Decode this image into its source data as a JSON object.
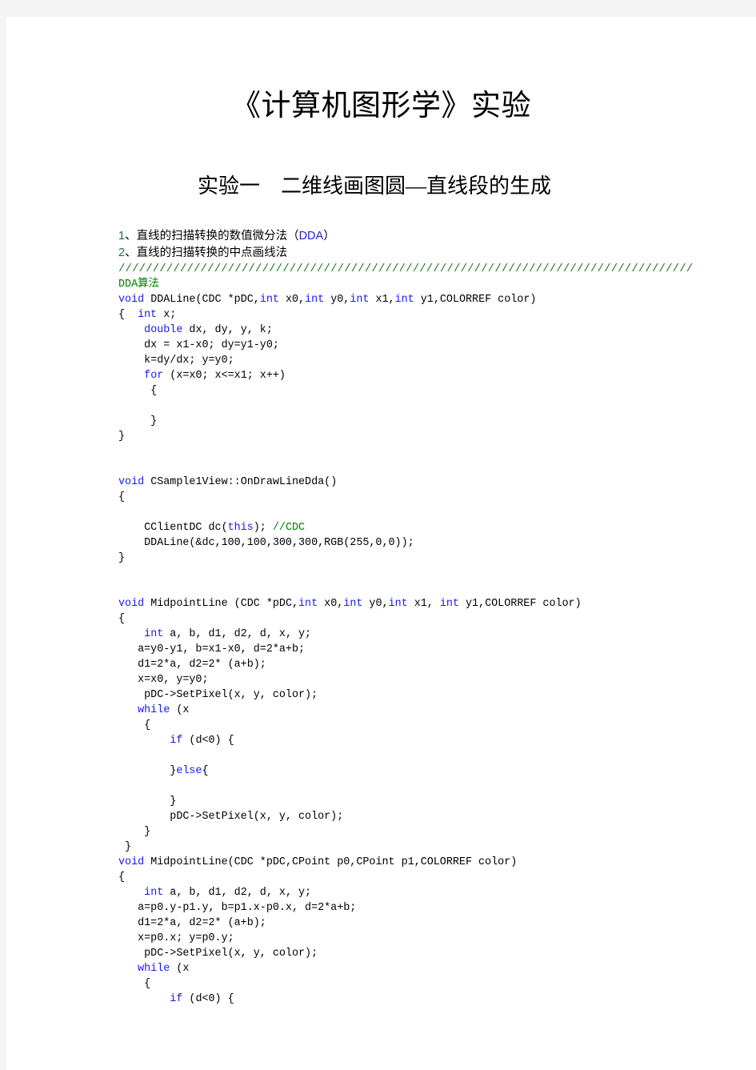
{
  "document": {
    "title": "《计算机图形学》实验",
    "subtitle": "实验一　二维线画图圆—直线段的生成"
  },
  "objectives": [
    {
      "num": "1",
      "sep": "、",
      "text": "直线的扫描转换的数值微分法（",
      "code": "DDA",
      "tail": "）"
    },
    {
      "num": "2",
      "sep": "、",
      "text": "直线的扫描转换的中点画线法",
      "code": "",
      "tail": ""
    }
  ],
  "separator": "////////////////////////////////////////////////////////////////////////////////////",
  "section_label": {
    "code": "DDA",
    "cn": "算法"
  },
  "code_lines": [
    {
      "segs": [
        {
          "t": "void",
          "c": "kw"
        },
        {
          "t": " DDALine(CDC *pDC,",
          "c": ""
        },
        {
          "t": "int",
          "c": "kw"
        },
        {
          "t": " x0,",
          "c": ""
        },
        {
          "t": "int",
          "c": "kw"
        },
        {
          "t": " y0,",
          "c": ""
        },
        {
          "t": "int",
          "c": "kw"
        },
        {
          "t": " x1,",
          "c": ""
        },
        {
          "t": "int",
          "c": "kw"
        },
        {
          "t": " y1,COLORREF color)",
          "c": ""
        }
      ]
    },
    {
      "segs": [
        {
          "t": "{  ",
          "c": ""
        },
        {
          "t": "int",
          "c": "kw"
        },
        {
          "t": " x;",
          "c": ""
        }
      ]
    },
    {
      "segs": [
        {
          "t": "    ",
          "c": ""
        },
        {
          "t": "double",
          "c": "kw"
        },
        {
          "t": " dx, dy, y, k;",
          "c": ""
        }
      ]
    },
    {
      "segs": [
        {
          "t": "    dx = x1-x0; dy=y1-y0;",
          "c": ""
        }
      ]
    },
    {
      "segs": [
        {
          "t": "    k=dy/dx; y=y0;",
          "c": ""
        }
      ]
    },
    {
      "segs": [
        {
          "t": "    ",
          "c": ""
        },
        {
          "t": "for",
          "c": "kw"
        },
        {
          "t": " (x=x0; x<=x1; x++)",
          "c": ""
        }
      ]
    },
    {
      "segs": [
        {
          "t": "     {",
          "c": ""
        }
      ]
    },
    {
      "segs": [
        {
          "t": "",
          "c": ""
        }
      ]
    },
    {
      "segs": [
        {
          "t": "     }",
          "c": ""
        }
      ]
    },
    {
      "segs": [
        {
          "t": "}",
          "c": ""
        }
      ]
    },
    {
      "segs": [
        {
          "t": "",
          "c": ""
        }
      ]
    },
    {
      "segs": [
        {
          "t": "",
          "c": ""
        }
      ]
    },
    {
      "segs": [
        {
          "t": "void",
          "c": "kw"
        },
        {
          "t": " CSample1View::OnDrawLineDda()",
          "c": ""
        }
      ]
    },
    {
      "segs": [
        {
          "t": "{",
          "c": ""
        }
      ]
    },
    {
      "segs": [
        {
          "t": "",
          "c": ""
        }
      ]
    },
    {
      "segs": [
        {
          "t": "    CClientDC dc(",
          "c": ""
        },
        {
          "t": "this",
          "c": "kw"
        },
        {
          "t": "); ",
          "c": ""
        },
        {
          "t": "//CDC",
          "c": "com"
        }
      ]
    },
    {
      "segs": [
        {
          "t": "    DDALine(&dc,100,100,300,300,RGB(255,0,0));",
          "c": ""
        }
      ]
    },
    {
      "segs": [
        {
          "t": "}",
          "c": ""
        }
      ]
    },
    {
      "segs": [
        {
          "t": "",
          "c": ""
        }
      ]
    },
    {
      "segs": [
        {
          "t": "",
          "c": ""
        }
      ]
    },
    {
      "segs": [
        {
          "t": "void",
          "c": "kw"
        },
        {
          "t": " MidpointLine (CDC *pDC,",
          "c": ""
        },
        {
          "t": "int",
          "c": "kw"
        },
        {
          "t": " x0,",
          "c": ""
        },
        {
          "t": "int",
          "c": "kw"
        },
        {
          "t": " y0,",
          "c": ""
        },
        {
          "t": "int",
          "c": "kw"
        },
        {
          "t": " x1, ",
          "c": ""
        },
        {
          "t": "int",
          "c": "kw"
        },
        {
          "t": " y1,COLORREF color)",
          "c": ""
        }
      ]
    },
    {
      "segs": [
        {
          "t": "{",
          "c": ""
        }
      ]
    },
    {
      "segs": [
        {
          "t": "    ",
          "c": ""
        },
        {
          "t": "int",
          "c": "kw"
        },
        {
          "t": " a, b, d1, d2, d, x, y;",
          "c": ""
        }
      ]
    },
    {
      "segs": [
        {
          "t": "   a=y0-y1, b=x1-x0, d=2*a+b;",
          "c": ""
        }
      ]
    },
    {
      "segs": [
        {
          "t": "   d1=2*a, d2=2* (a+b);",
          "c": ""
        }
      ]
    },
    {
      "segs": [
        {
          "t": "   x=x0, y=y0;",
          "c": ""
        }
      ]
    },
    {
      "segs": [
        {
          "t": "    pDC->SetPixel(x, y, color);",
          "c": ""
        }
      ]
    },
    {
      "segs": [
        {
          "t": "   ",
          "c": ""
        },
        {
          "t": "while",
          "c": "kw"
        },
        {
          "t": " (x",
          "c": ""
        }
      ]
    },
    {
      "segs": [
        {
          "t": "    {",
          "c": ""
        }
      ]
    },
    {
      "segs": [
        {
          "t": "        ",
          "c": ""
        },
        {
          "t": "if",
          "c": "kw"
        },
        {
          "t": " (d<0) {",
          "c": ""
        }
      ]
    },
    {
      "segs": [
        {
          "t": "",
          "c": ""
        }
      ]
    },
    {
      "segs": [
        {
          "t": "        }",
          "c": ""
        },
        {
          "t": "else",
          "c": "kw"
        },
        {
          "t": "{",
          "c": ""
        }
      ]
    },
    {
      "segs": [
        {
          "t": "",
          "c": ""
        }
      ]
    },
    {
      "segs": [
        {
          "t": "        }",
          "c": ""
        }
      ]
    },
    {
      "segs": [
        {
          "t": "        pDC->SetPixel(x, y, color);",
          "c": ""
        }
      ]
    },
    {
      "segs": [
        {
          "t": "    }",
          "c": ""
        }
      ]
    },
    {
      "segs": [
        {
          "t": " }",
          "c": ""
        }
      ]
    },
    {
      "segs": [
        {
          "t": "void",
          "c": "kw"
        },
        {
          "t": " MidpointLine(CDC *pDC,CPoint p0,CPoint p1,COLORREF color)",
          "c": ""
        }
      ]
    },
    {
      "segs": [
        {
          "t": "{",
          "c": ""
        }
      ]
    },
    {
      "segs": [
        {
          "t": "    ",
          "c": ""
        },
        {
          "t": "int",
          "c": "kw"
        },
        {
          "t": " a, b, d1, d2, d, x, y;",
          "c": ""
        }
      ]
    },
    {
      "segs": [
        {
          "t": "   a=p0.y-p1.y, b=p1.x-p0.x, d=2*a+b;",
          "c": ""
        }
      ]
    },
    {
      "segs": [
        {
          "t": "   d1=2*a, d2=2* (a+b);",
          "c": ""
        }
      ]
    },
    {
      "segs": [
        {
          "t": "   x=p0.x; y=p0.y;",
          "c": ""
        }
      ]
    },
    {
      "segs": [
        {
          "t": "    pDC->SetPixel(x, y, color);",
          "c": ""
        }
      ]
    },
    {
      "segs": [
        {
          "t": "   ",
          "c": ""
        },
        {
          "t": "while",
          "c": "kw"
        },
        {
          "t": " (x",
          "c": ""
        }
      ]
    },
    {
      "segs": [
        {
          "t": "    {",
          "c": ""
        }
      ]
    },
    {
      "segs": [
        {
          "t": "        ",
          "c": ""
        },
        {
          "t": "if",
          "c": "kw"
        },
        {
          "t": " (d<0) {",
          "c": ""
        }
      ]
    }
  ],
  "colors": {
    "keyword": "#1a1aec",
    "comment": "#008000",
    "separator": "#1d7322",
    "text": "#000000",
    "page_bg": "#ffffff",
    "canvas_bg": "#f4f4f4"
  }
}
